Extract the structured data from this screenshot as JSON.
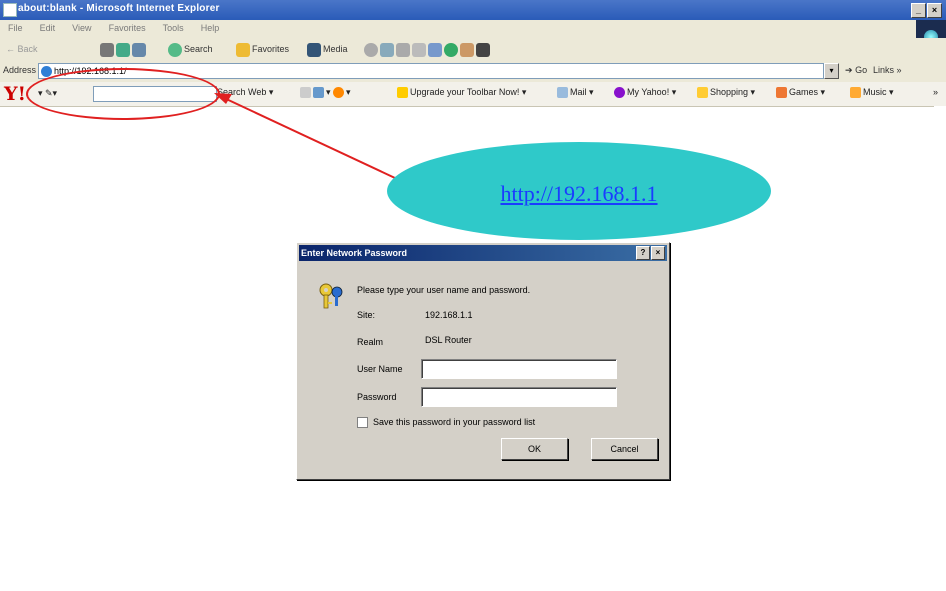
{
  "window": {
    "title": "about:blank - Microsoft Internet Explorer",
    "controls": [
      "_",
      "×"
    ]
  },
  "menu": [
    "File",
    "Edit",
    "View",
    "Favorites",
    "Tools",
    "Help"
  ],
  "toolbar": {
    "back_label": "← Back",
    "search_label": "Search",
    "favorites_label": "Favorites",
    "media_label": "Media"
  },
  "address_bar": {
    "label": "Address",
    "value": "http://192.168.1.1/",
    "go_label": "Go",
    "links_label": "Links »"
  },
  "yahoo_toolbar": {
    "logo": "Y!",
    "search_button": "Search Web ▾",
    "items": [
      "Upgrade your Toolbar Now! ▾",
      "Mail ▾",
      "My Yahoo! ▾",
      "Shopping ▾",
      "Games ▾",
      "Music ▾",
      "»"
    ]
  },
  "callout": {
    "link_text": "http://192.168.1.1"
  },
  "dialog": {
    "title": "Enter Network Password",
    "prompt": "Please type your user name and password.",
    "site_label": "Site:",
    "site_value": "192.168.1.1",
    "realm_label": "Realm",
    "realm_value": "DSL Router",
    "username_label": "User Name",
    "username_value": "",
    "password_label": "Password",
    "password_value": "",
    "save_password_label": "Save this password in your password list",
    "save_password_checked": false,
    "ok_label": "OK",
    "cancel_label": "Cancel",
    "title_buttons": [
      "?",
      "×"
    ]
  },
  "colors": {
    "annotation_red": "#e02020",
    "callout_fill": "#2fc9c9",
    "link_blue": "#1a3cff",
    "dialog_title": "#0a246a"
  }
}
